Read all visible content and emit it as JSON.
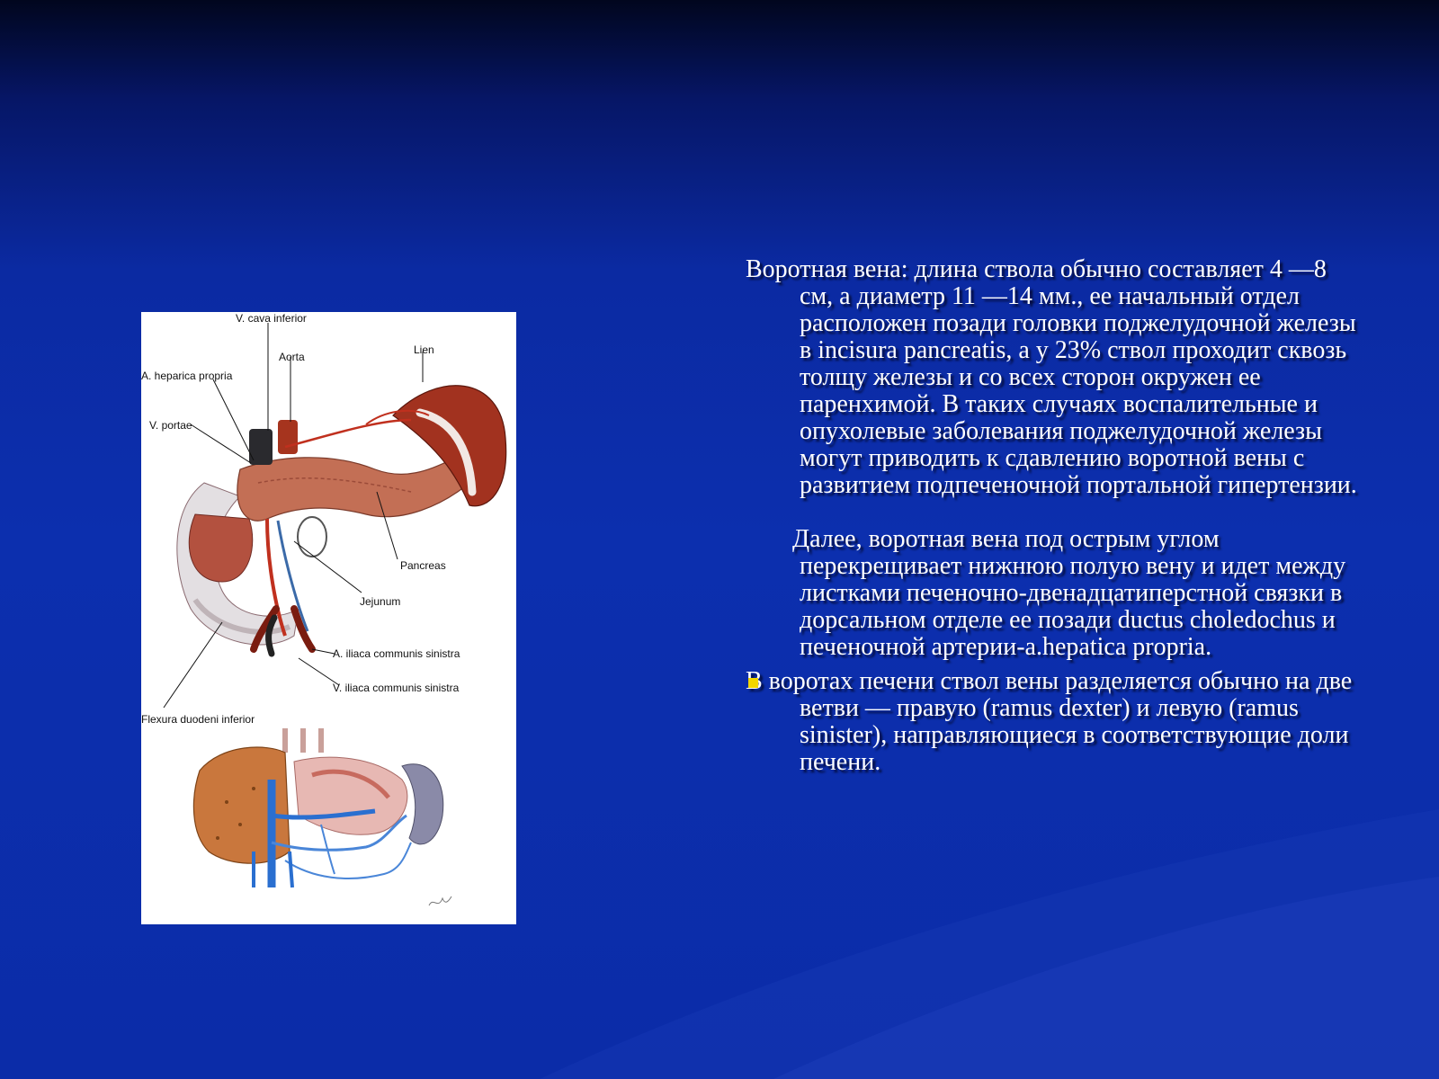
{
  "colors": {
    "background_top": "#01061e",
    "background_main": "#0c2fae",
    "text": "#ffffff",
    "bullet": "#f2d600"
  },
  "figure": {
    "labels": {
      "v_cava_inferior": "V. cava inferior",
      "aorta": "Aorta",
      "lien": "Lien",
      "a_hepatica_propria": "A. heparica propria",
      "v_portae": "V. portae",
      "pancreas": "Pancreas",
      "jejunum": "Jejunum",
      "a_iliaca_communis_sinistra": "A. iliaca communis sinistra",
      "v_iliaca_communis_sinistra": "V. iliaca communis sinistra",
      "flexura_duodeni_inferior": "Flexura duodeni inferior"
    }
  },
  "content": {
    "paragraph_1": "Воротная вена: длина ствола обычно составляет 4 —8 см, а диаметр 11 —14 мм., ее начальный отдел расположен позади головки поджелудочной железы в incisura pancreatis, а у 23% ствол проходит сквозь толщу железы и со всех сторон окружен ее паренхимой. В таких случаях воспалительные и опухолевые заболевания поджелудочной железы могут приводить к сдавлению воротной вены с развитием подпеченочной портальной гипертензии.",
    "paragraph_2": "Далее, воротная вена под острым углом перекрещивает нижнюю полую вену и идет между листками печеночно-двенадцатиперстной связки в дорсальном отделе ее позади ductus choledochus и печеночной артерии-a.hepatica propria.",
    "paragraph_3": " В воротах печени ствол вены разделяется обычно на две ветви — правую (ramus dexter) и левую (ramus sinister), направляющиеся в соответствующие доли печени."
  }
}
